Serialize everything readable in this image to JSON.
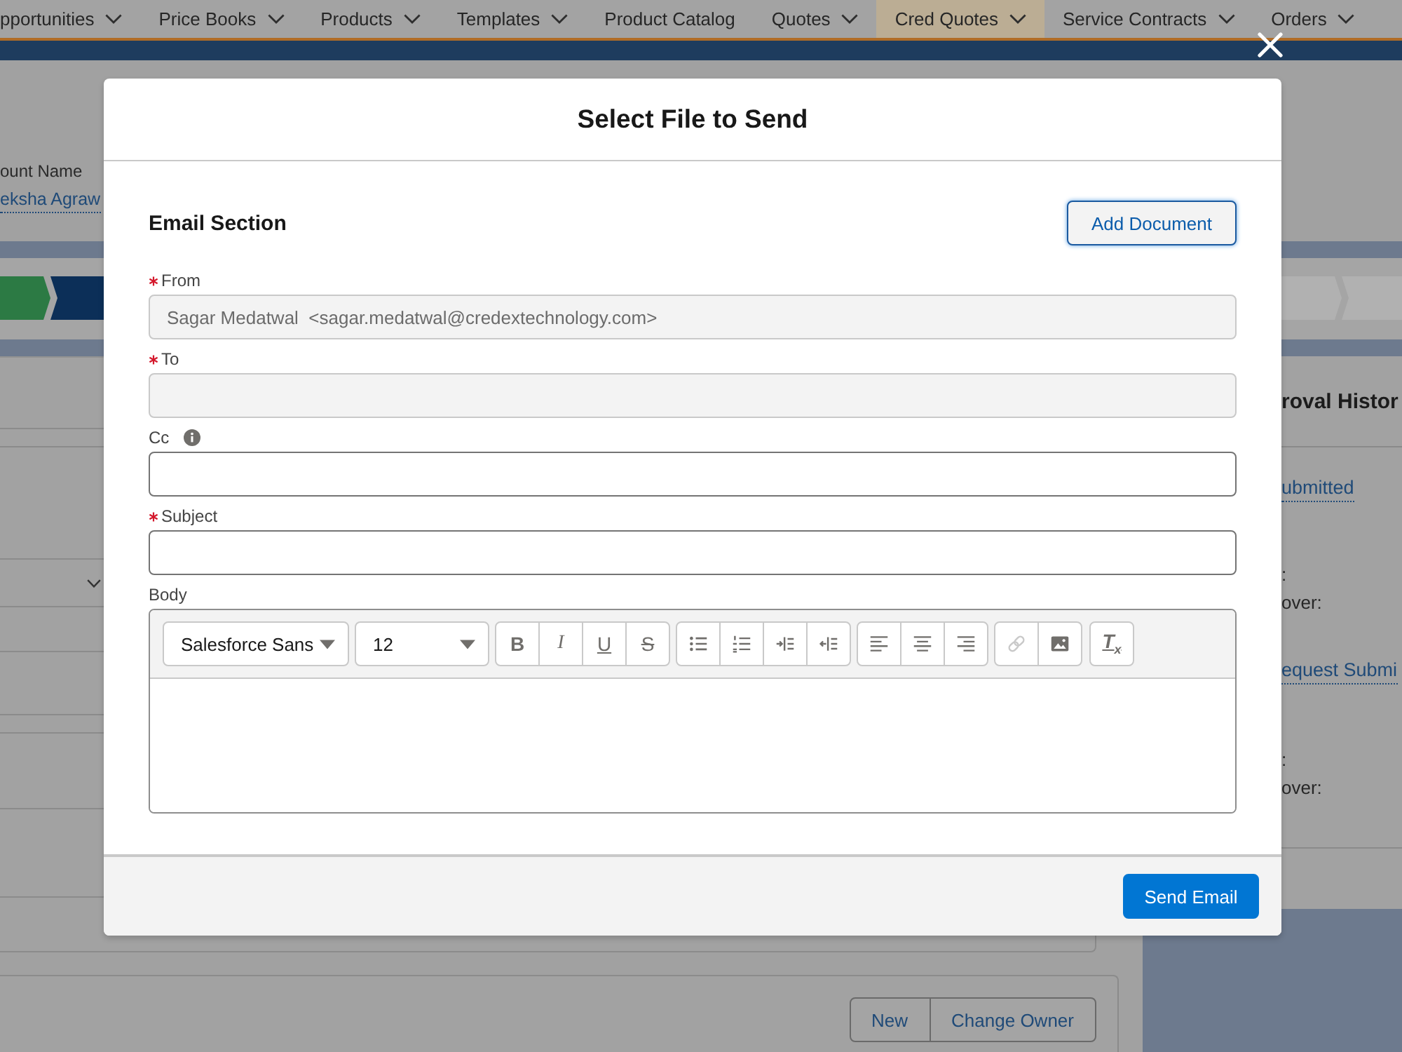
{
  "page": {
    "nav_tabs": [
      {
        "label": "pportunities",
        "has_menu": true,
        "selected": false
      },
      {
        "label": "Price Books",
        "has_menu": true,
        "selected": false
      },
      {
        "label": "Products",
        "has_menu": true,
        "selected": false
      },
      {
        "label": "Templates",
        "has_menu": true,
        "selected": false
      },
      {
        "label": "Product Catalog",
        "has_menu": false,
        "selected": false
      },
      {
        "label": "Quotes",
        "has_menu": true,
        "selected": false
      },
      {
        "label": "Cred Quotes",
        "has_menu": true,
        "selected": true
      },
      {
        "label": "Service Contracts",
        "has_menu": true,
        "selected": false
      },
      {
        "label": "Orders",
        "has_menu": true,
        "selected": false
      }
    ],
    "record_field": {
      "label": "ount Name",
      "value": "eksha Agraw"
    },
    "path_stages": [
      {
        "kind": "complete"
      },
      {
        "kind": "current"
      },
      {
        "kind": "upcoming"
      },
      {
        "kind": "upcoming"
      }
    ],
    "approval_history": {
      "title": "roval Histor",
      "steps": [
        {
          "link": "ubmitted",
          "lines": [
            ":",
            "over:"
          ]
        },
        {
          "link": "equest Submi",
          "lines": [
            ":",
            "over:"
          ]
        }
      ]
    },
    "actions": [
      "New",
      "Change Owner"
    ]
  },
  "modal": {
    "title": "Select File to Send",
    "section_title": "Email Section",
    "add_button": "Add Document",
    "fields": [
      {
        "label": "From",
        "required": true,
        "disabled": true,
        "info": false,
        "value": "Sagar Medatwal  <sagar.medatwal@credextechnology.com>"
      },
      {
        "label": "To",
        "required": true,
        "disabled": true,
        "info": false
      },
      {
        "label": "Cc",
        "required": false,
        "disabled": false,
        "info": true
      },
      {
        "label": "Subject",
        "required": true,
        "disabled": false,
        "info": false
      }
    ],
    "body": {
      "label": "Body",
      "font": "Salesforce Sans",
      "size": "12",
      "toolbar_groups": [
        {
          "buttons": [
            {
              "kind": "bold",
              "glyph": "B",
              "disabled": false
            },
            {
              "kind": "italic",
              "glyph": "I",
              "disabled": false
            },
            {
              "kind": "underline",
              "glyph": "U",
              "disabled": false
            },
            {
              "kind": "strikethrough",
              "glyph": "S",
              "disabled": false
            }
          ]
        },
        {
          "buttons": [
            {
              "kind": "bulleted_list",
              "disabled": false
            },
            {
              "kind": "numbered_list",
              "disabled": false
            },
            {
              "kind": "indent",
              "disabled": false
            },
            {
              "kind": "outdent",
              "disabled": false
            }
          ]
        },
        {
          "buttons": [
            {
              "kind": "align_left",
              "disabled": false
            },
            {
              "kind": "align_center",
              "disabled": false
            },
            {
              "kind": "align_right",
              "disabled": false
            }
          ]
        },
        {
          "buttons": [
            {
              "kind": "link",
              "disabled": true
            },
            {
              "kind": "image",
              "disabled": false
            }
          ]
        },
        {
          "buttons": [
            {
              "kind": "clear_format",
              "glyph": "T$_{x}$",
              "disabled": false
            }
          ]
        }
      ]
    },
    "send_button": "Send Email"
  }
}
